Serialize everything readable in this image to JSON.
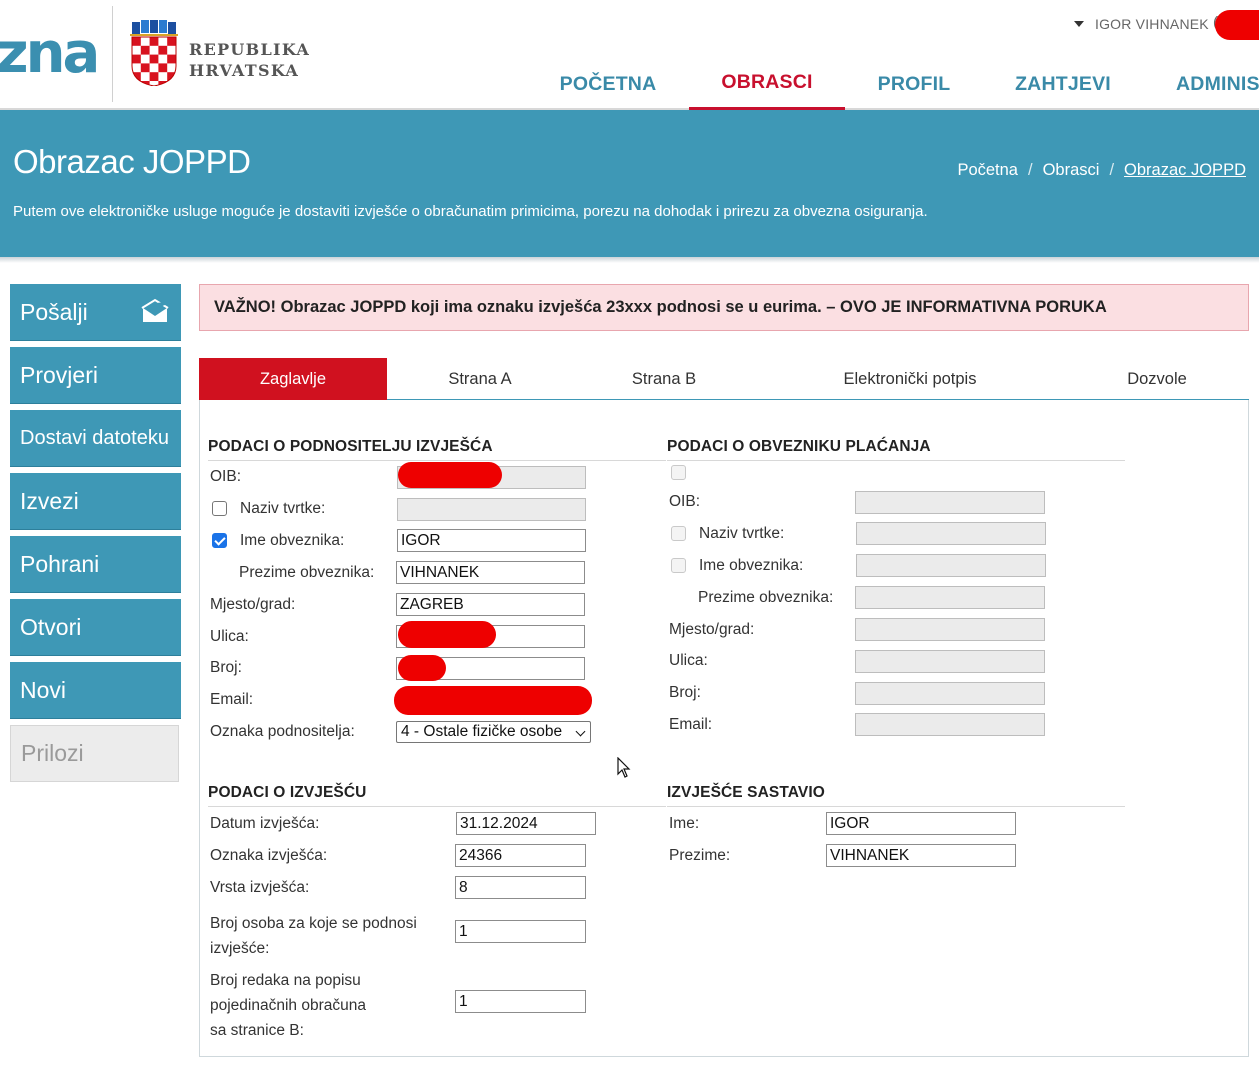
{
  "header": {
    "logo_partial": "zna",
    "republic_line1": "REPUBLIKA",
    "republic_line2": "HRVATSKA",
    "user_name": "IGOR VIHNANEK",
    "user_avatar_paren": "(",
    "nav": [
      {
        "label": "POČETNA",
        "active": false
      },
      {
        "label": "OBRASCI",
        "active": true
      },
      {
        "label": "PROFIL",
        "active": false
      },
      {
        "label": "ZAHTJEVI",
        "active": false
      },
      {
        "label": "ADMINIS",
        "active": false
      }
    ]
  },
  "hero": {
    "title": "Obrazac JOPPD",
    "description": "Putem ove elektroničke usluge moguće je dostaviti izvješće o obračunatim primicima, porezu na dohodak i prirezu za obvezna osiguranja.",
    "breadcrumb": [
      "Početna",
      "Obrasci",
      "Obrazac JOPPD"
    ],
    "breadcrumb_sep": "/"
  },
  "sidebar": {
    "items": [
      {
        "label": "Pošalji",
        "enabled": true
      },
      {
        "label": "Provjeri",
        "enabled": true
      },
      {
        "label": "Dostavi datoteku",
        "enabled": true
      },
      {
        "label": "Izvezi",
        "enabled": true
      },
      {
        "label": "Pohrani",
        "enabled": true
      },
      {
        "label": "Otvori",
        "enabled": true
      },
      {
        "label": "Novi",
        "enabled": true
      },
      {
        "label": "Prilozi",
        "enabled": false
      }
    ]
  },
  "alert": {
    "text": "VAŽNO! Obrazac JOPPD koji ima oznaku izvješća 23xxx podnosi se u eurima. – OVO JE INFORMATIVNA PORUKA"
  },
  "tabs": [
    {
      "label": "Zaglavlje",
      "active": true
    },
    {
      "label": "Strana A",
      "active": false
    },
    {
      "label": "Strana B",
      "active": false
    },
    {
      "label": "Elektronički potpis",
      "active": false
    },
    {
      "label": "Dozvole",
      "active": false
    }
  ],
  "podnositelj": {
    "title": "PODACI O PODNOSITELJU IZVJEŠĆA",
    "oib_label": "OIB:",
    "naziv_label": "Naziv tvrtke:",
    "naziv_checked": false,
    "ime_label": "Ime obveznika:",
    "ime_checked": true,
    "ime_value": "IGOR",
    "prezime_label": "Prezime obveznika:",
    "prezime_value": "VIHNANEK",
    "mjesto_label": "Mjesto/grad:",
    "mjesto_value": "ZAGREB",
    "ulica_label": "Ulica:",
    "broj_label": "Broj:",
    "email_label": "Email:",
    "oznaka_label": "Oznaka podnositelja:",
    "oznaka_value": "4 - Ostale fizičke osobe"
  },
  "obveznik": {
    "title": "PODACI O OBVEZNIKU PLAĆANJA",
    "oib_label": "OIB:",
    "naziv_label": "Naziv tvrtke:",
    "ime_label": "Ime obveznika:",
    "prezime_label": "Prezime obveznika:",
    "mjesto_label": "Mjesto/grad:",
    "ulica_label": "Ulica:",
    "broj_label": "Broj:",
    "email_label": "Email:"
  },
  "izvjesce": {
    "title": "PODACI O IZVJEŠĆU",
    "datum_label": "Datum izvješća:",
    "datum_value": "31.12.2024",
    "oznaka_label": "Oznaka izvješća:",
    "oznaka_value": "24366",
    "vrsta_label": "Vrsta izvješća:",
    "vrsta_value": "8",
    "broj_osoba_label_1": "Broj osoba za koje se podnosi",
    "broj_osoba_label_2": "izvješće:",
    "broj_osoba_value": "1",
    "broj_redaka_label_1": "Broj redaka na popisu",
    "broj_redaka_label_2": "pojedinačnih obračuna",
    "broj_redaka_label_3": "sa stranice B:",
    "broj_redaka_value": "1"
  },
  "sastavio": {
    "title": "IZVJEŠĆE SASTAVIO",
    "ime_label": "Ime:",
    "ime_value": "IGOR",
    "prezime_label": "Prezime:",
    "prezime_value": "VIHNANEK"
  },
  "colors": {
    "primary": "#3e98b6",
    "accent_red": "#c8102e",
    "alert_bg": "#fbdfe2"
  }
}
